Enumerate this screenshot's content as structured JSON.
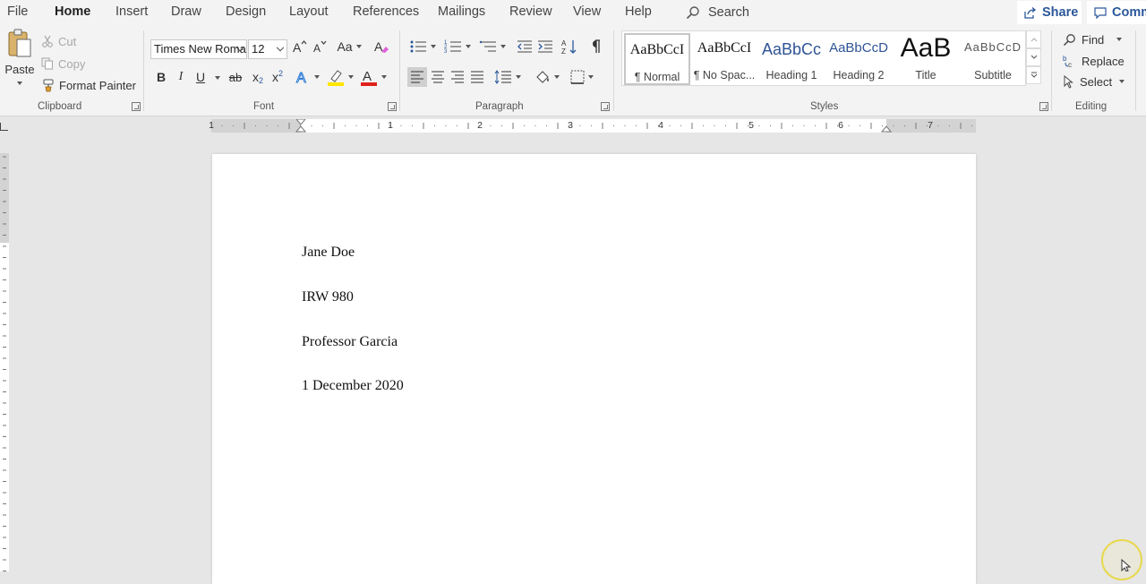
{
  "tabs": [
    {
      "label": "File",
      "active": false
    },
    {
      "label": "Home",
      "active": true
    },
    {
      "label": "Insert",
      "active": false
    },
    {
      "label": "Draw",
      "active": false
    },
    {
      "label": "Design",
      "active": false
    },
    {
      "label": "Layout",
      "active": false
    },
    {
      "label": "References",
      "active": false
    },
    {
      "label": "Mailings",
      "active": false
    },
    {
      "label": "Review",
      "active": false
    },
    {
      "label": "View",
      "active": false
    },
    {
      "label": "Help",
      "active": false
    }
  ],
  "search": {
    "label": "Search"
  },
  "share": {
    "label": "Share"
  },
  "comments": {
    "label": "Comm"
  },
  "clipboard": {
    "paste_label": "Paste",
    "cut_label": "Cut",
    "copy_label": "Copy",
    "format_painter_label": "Format Painter",
    "group_label": "Clipboard"
  },
  "font": {
    "family": "Times New Roman",
    "size": "12",
    "change_case_label": "Aa",
    "bold": "B",
    "italic": "I",
    "underline": "U",
    "strike": "ab",
    "subscript": "x",
    "superscript": "x",
    "group_label": "Font",
    "highlight_color": "#ffe600",
    "font_color": "#e0201a"
  },
  "paragraph": {
    "group_label": "Paragraph"
  },
  "styles": {
    "group_label": "Styles",
    "items": [
      {
        "preview": "AaBbCcI",
        "name": "¶ Normal",
        "selected": true
      },
      {
        "preview": "AaBbCcI",
        "name": "¶ No Spac...",
        "selected": false
      },
      {
        "preview": "AaBbCc",
        "name": "Heading 1",
        "selected": false
      },
      {
        "preview": "AaBbCcD",
        "name": "Heading 2",
        "selected": false
      },
      {
        "preview": "AaB",
        "name": "Title",
        "selected": false
      },
      {
        "preview": "AaBbCcD",
        "name": "Subtitle",
        "selected": false
      }
    ]
  },
  "editing": {
    "find_label": "Find",
    "replace_label": "Replace",
    "select_label": "Select",
    "group_label": "Editing"
  },
  "ruler": {
    "numbers": [
      "1",
      "1",
      "2",
      "3",
      "4",
      "5",
      "6",
      "7"
    ]
  },
  "document": {
    "lines": [
      "Jane Doe",
      "IRW 980",
      "Professor Garcia",
      "1 December 2020"
    ]
  },
  "colors": {
    "accent": "#2b579a"
  }
}
